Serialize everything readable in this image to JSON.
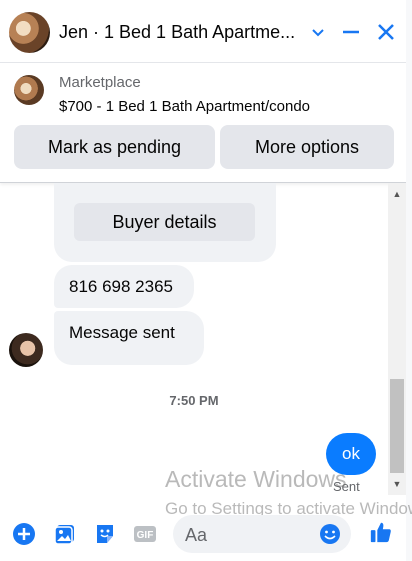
{
  "header": {
    "title": "Jen · 1 Bed 1 Bath Apartme...",
    "icons": [
      "chevron-down-icon",
      "minimize-icon",
      "close-icon"
    ]
  },
  "marketplace": {
    "source": "Marketplace",
    "item": "$700 - 1 Bed 1 Bath Apartment/condo",
    "mark_pending_label": "Mark as pending",
    "more_options_label": "More options"
  },
  "conversation": {
    "buyer_details_label": "Buyer details",
    "messages": [
      {
        "text": "816 698 2365"
      },
      {
        "text": "Message sent"
      }
    ],
    "timestamp": "7:50 PM",
    "outgoing": {
      "text": "ok",
      "status": "Sent"
    }
  },
  "composer": {
    "placeholder": "Aa",
    "icons": [
      "plus-icon",
      "photo-icon",
      "sticker-icon",
      "gif-icon",
      "emoji-icon",
      "like-icon"
    ]
  },
  "watermark": {
    "line1": "Activate Windows",
    "line2": "Go to Settings to activate Windows."
  },
  "colors": {
    "accent": "#1877f2",
    "outgoing_bubble": "#0a7cff",
    "incoming_bubble": "#f0f2f5",
    "button_bg": "#e4e6eb"
  }
}
